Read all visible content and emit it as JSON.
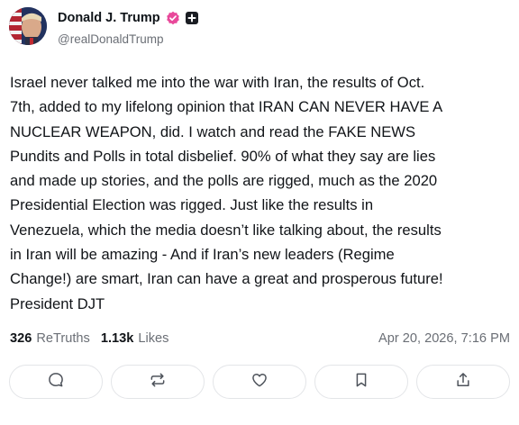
{
  "author": {
    "display_name": "Donald J. Trump",
    "handle": "@realDonaldTrump",
    "avatar_icon": "avatar-portrait",
    "verified_icon": "verified-badge-icon",
    "verified_color": "#e8489a",
    "plus_icon": "plus-badge-icon"
  },
  "post": {
    "text": "Israel never talked me into the war with Iran, the results of Oct.\n7th, added to my lifelong opinion that IRAN CAN NEVER HAVE A\nNUCLEAR WEAPON, did. I watch and read the FAKE NEWS\nPundits and Polls in total disbelief. 90% of what they say are lies\nand made up stories, and the polls are rigged, much as the 2020\nPresidential Election was rigged. Just like the results in\nVenezuela, which the media doesn’t like talking about, the results\nin Iran will be amazing - And if Iran’s new leaders (Regime\nChange!) are smart, Iran can have a great and prosperous future!\nPresident DJT"
  },
  "stats": {
    "retruths_count": "326",
    "retruths_label": "ReTruths",
    "likes_count": "1.13k",
    "likes_label": "Likes",
    "timestamp": "Apr 20, 2026, 7:16 PM"
  },
  "actions": [
    {
      "icon": "reply-icon"
    },
    {
      "icon": "retruth-icon"
    },
    {
      "icon": "like-icon"
    },
    {
      "icon": "bookmark-icon"
    },
    {
      "icon": "share-icon"
    }
  ]
}
